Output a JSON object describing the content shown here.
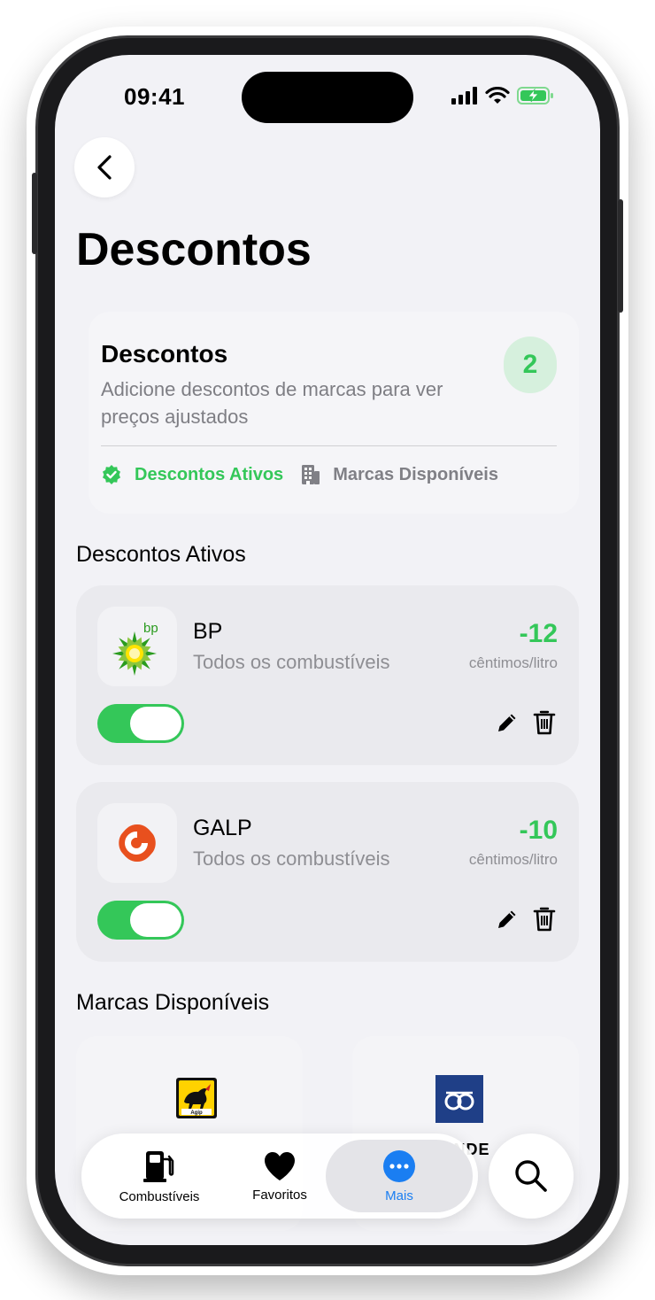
{
  "status_bar": {
    "time": "09:41"
  },
  "header": {
    "title": "Descontos"
  },
  "summary": {
    "title": "Descontos",
    "description": "Adicione descontos de marcas para ver preços ajustados",
    "count": "2",
    "links": [
      {
        "label": "Descontos Ativos",
        "icon": "verified-badge-icon",
        "color": "#34c759"
      },
      {
        "label": "Marcas Disponíveis",
        "icon": "building-icon",
        "color": "#808086"
      }
    ]
  },
  "active_section": {
    "title": "Descontos Ativos"
  },
  "discounts": [
    {
      "brand": "BP",
      "fuel": "Todos os combustíveis",
      "value": "-12",
      "unit": "cêntimos/litro",
      "enabled": true,
      "logo": "bp-logo"
    },
    {
      "brand": "GALP",
      "fuel": "Todos os combustíveis",
      "value": "-10",
      "unit": "cêntimos/litro",
      "enabled": true,
      "logo": "galp-logo"
    }
  ],
  "available_section": {
    "title": "Marcas Disponíveis",
    "brands": [
      {
        "logo": "agip-logo",
        "logo_text": "Agip"
      },
      {
        "logo": "santander-logo",
        "name": "ANDE"
      }
    ]
  },
  "tabbar": {
    "tabs": [
      {
        "label": "Combustíveis",
        "icon": "fuel-pump-icon"
      },
      {
        "label": "Favoritos",
        "icon": "heart-icon"
      },
      {
        "label": "Mais",
        "icon": "more-icon",
        "active": true
      }
    ],
    "search_icon": "search-icon"
  },
  "colors": {
    "accent_green": "#34c759",
    "accent_blue": "#1a7ef2",
    "background": "#f2f2f6"
  }
}
